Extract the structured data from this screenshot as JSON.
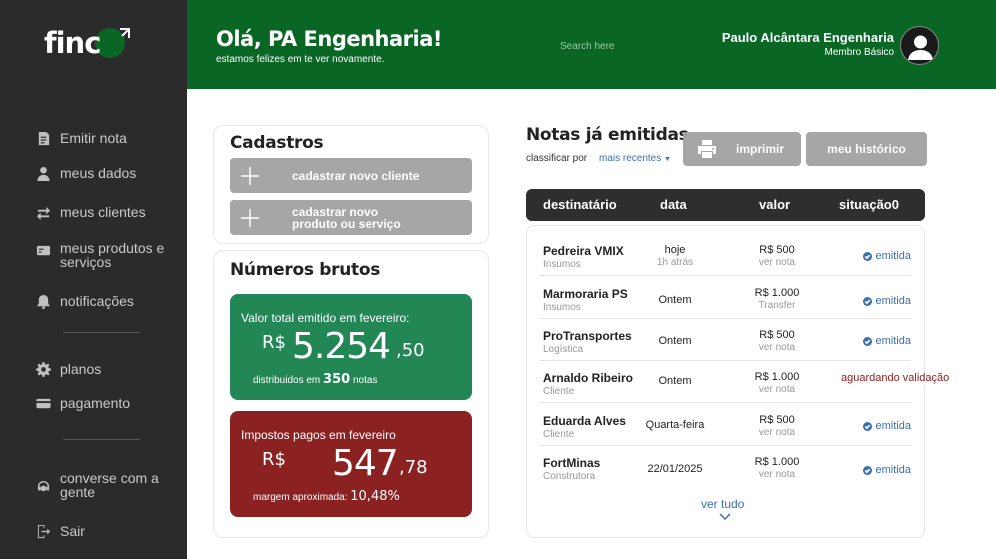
{
  "brand": {
    "logo_text": "finc"
  },
  "sidebar": {
    "items": [
      {
        "label": "Emitir nota",
        "icon": "document-icon"
      },
      {
        "label": "meus dados",
        "icon": "user-icon"
      },
      {
        "label": "meus clientes",
        "icon": "swap-icon"
      },
      {
        "label": "meus produtos e serviços",
        "icon": "card-icon"
      },
      {
        "label": "notificações",
        "icon": "bell-icon"
      },
      {
        "label": "planos",
        "icon": "gear-icon"
      },
      {
        "label": "pagamento",
        "icon": "credit-card-icon"
      },
      {
        "label": "converse com a gente",
        "icon": "headset-icon"
      },
      {
        "label": "Sair",
        "icon": "logout-icon"
      }
    ]
  },
  "header": {
    "greeting": "Olá, PA Engenharia!",
    "subtitle": "estamos felizes em te ver novamente.",
    "search_placeholder": "Search here",
    "user_name": "Paulo Alcântara Engenharia",
    "user_role": "Membro Básico"
  },
  "cadastros": {
    "title": "Cadastros",
    "new_client": "cadastrar novo cliente",
    "new_product": "cadastrar novo produto ou serviço"
  },
  "numeros": {
    "title": "Números brutos",
    "emitted": {
      "label": "Valor total emitido em fevereiro:",
      "currency": "R$",
      "integer": "5.254",
      "cents": ",50",
      "foot_prefix": "distribuidos em",
      "count": "350",
      "foot_suffix": "notas"
    },
    "taxes": {
      "label": "Impostos pagos em fevereiro",
      "currency": "R$",
      "integer": "547",
      "cents": ",78",
      "foot_prefix": "margem aproximada:",
      "pct": "10,48%"
    }
  },
  "notas": {
    "title": "Notas já emitidas",
    "sort_label": "classificar por",
    "sort_value": "mais recentes",
    "print_label": "imprimir",
    "history_label": "meu histórico",
    "columns": [
      "destinatário",
      "data",
      "valor",
      "situação0"
    ],
    "rows": [
      {
        "name": "Pedreira VMIX",
        "category": "Insumos",
        "date": "hoje",
        "date_sub": "1h atrás",
        "value": "R$ 500",
        "value_sub": "ver nota",
        "status": "emitida"
      },
      {
        "name": "Marmoraria PS",
        "category": "Insumos",
        "date": "Ontem",
        "date_sub": "",
        "value": "R$ 1.000",
        "value_sub": "Transfer",
        "status": "emitida"
      },
      {
        "name": "ProTransportes",
        "category": "Logística",
        "date": "Ontem",
        "date_sub": "",
        "value": "R$ 500",
        "value_sub": "ver nota",
        "status": "emitida"
      },
      {
        "name": "Arnaldo Ribeiro",
        "category": "Cliente",
        "date": "Ontem",
        "date_sub": "",
        "value": "R$ 1.000",
        "value_sub": "ver nota",
        "status": "aguardando validação"
      },
      {
        "name": "Eduarda Alves",
        "category": "Cliente",
        "date": "Quarta-feira",
        "date_sub": "",
        "value": "R$ 500",
        "value_sub": "ver nota",
        "status": "emitida"
      },
      {
        "name": "FortMinas",
        "category": "Construtora",
        "date": "22/01/2025",
        "date_sub": "",
        "value": "R$ 1.000",
        "value_sub": "ver nota",
        "status": "emitida"
      }
    ],
    "see_all": "ver tudo"
  },
  "colors": {
    "brand_green": "#0a6624",
    "stat_green": "#228755",
    "stat_red": "#8b2121",
    "sidebar": "#2b2b2b",
    "link_blue": "#3a6fb0"
  }
}
